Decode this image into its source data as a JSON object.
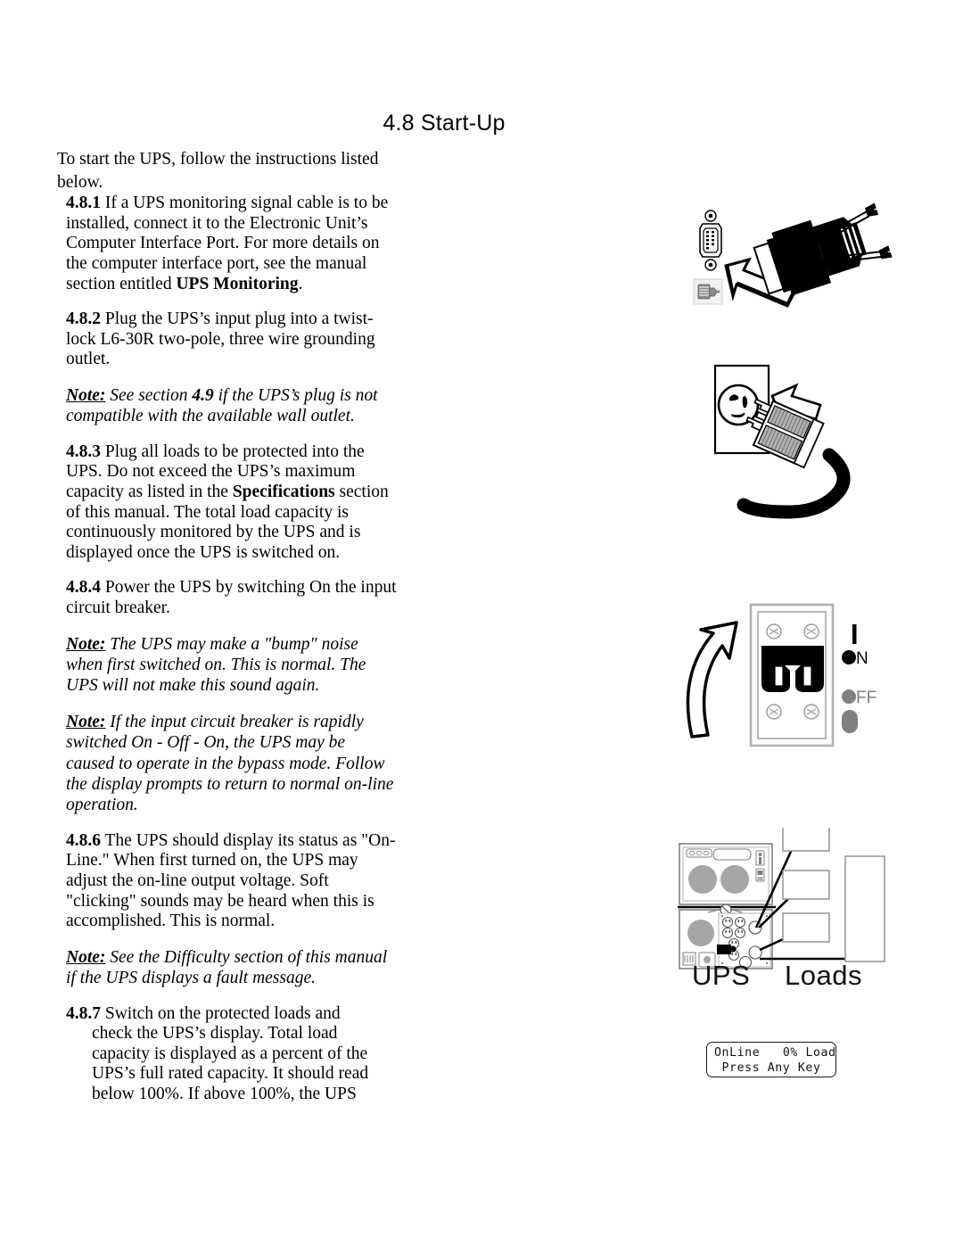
{
  "document": {
    "title": "4.8 Start-Up",
    "intro": "To start the UPS, follow the instructions listed below."
  },
  "steps": [
    {
      "number": "4.8.1",
      "text_parts": [
        {
          "t": "If a UPS monitoring signal cable is to be installed, connect it to the Electronic Unit’s Computer Interface Port. For more details on the computer interface port, see the manual section entitled ",
          "style": "normal"
        },
        {
          "t": "UPS Monitoring",
          "style": "bold"
        },
        {
          "t": ".",
          "style": "normal"
        }
      ],
      "plain": "If a UPS monitoring signal cable is to be installed, connect it to the Electronic Unit’s Computer Interface Port. For more details on the computer interface port, see the manual section entitled UPS Monitoring."
    },
    {
      "number": "4.8.2",
      "plain": "Plug the UPS’s input plug into a twist-lock L6-30R two-pole, three wire grounding outlet."
    },
    {
      "number": "4.8.3",
      "plain": "Plug all loads to be protected into the UPS. Do not exceed the UPS’s maximum capacity as listed in the Specifications section of this manual. The total load capacity is continuously monitored by the UPS and is displayed once the UPS is switched on.",
      "bold_run": "Specifications"
    },
    {
      "number": "4.8.4",
      "plain": "Power the UPS by switching On the input circuit breaker."
    },
    {
      "number": "4.8.6",
      "plain": "The UPS should display its status as \"On-Line.\" When first turned on, the UPS may adjust the on-line output voltage. Soft \"clicking\" sounds may be heard when this is accomplished. This is normal."
    },
    {
      "number": "4.8.7",
      "plain": "Switch on the protected loads and check the UPS’s display. Total load capacity is displayed as a percent of the UPS’s full rated capacity. It should read below 100%. If above 100%, the UPS"
    }
  ],
  "notes": [
    {
      "label": "Note:",
      "text_before": " See section ",
      "emphasis": "4.9",
      "text_after": " if the UPS’s plug is not compatible with the available wall outlet."
    },
    {
      "label": "Note:",
      "text": " The UPS may make a \"bump\" noise when first switched on. This is normal. The UPS will not make this sound again."
    },
    {
      "label": "Note:",
      "text": " If the input circuit breaker is rapidly switched On - Off - On, the UPS may be caused to operate in the bypass mode. Follow the display prompts to return to normal on-line operation."
    },
    {
      "label": "Note:",
      "text": " See the Difficulty section of this manual if the UPS displays a fault message."
    }
  ],
  "figures": {
    "serial": {
      "name": "serial-port-connection-figure"
    },
    "outlet": {
      "name": "wall-outlet-plug-figure"
    },
    "breaker": {
      "name": "circuit-breaker-figure",
      "on_label": "N",
      "off_label": "FF"
    },
    "ups_loads": {
      "name": "ups-loads-figure",
      "caption_ups": "UPS",
      "caption_loads": "Loads"
    }
  },
  "lcd": {
    "line1": "OnLine   0% Load",
    "line2": "Press Any Key"
  },
  "colors": {
    "ink": "#000000",
    "page": "#ffffff",
    "gray": "#808080",
    "light_gray": "#b3b3b3",
    "outline_gray": "#999999"
  }
}
